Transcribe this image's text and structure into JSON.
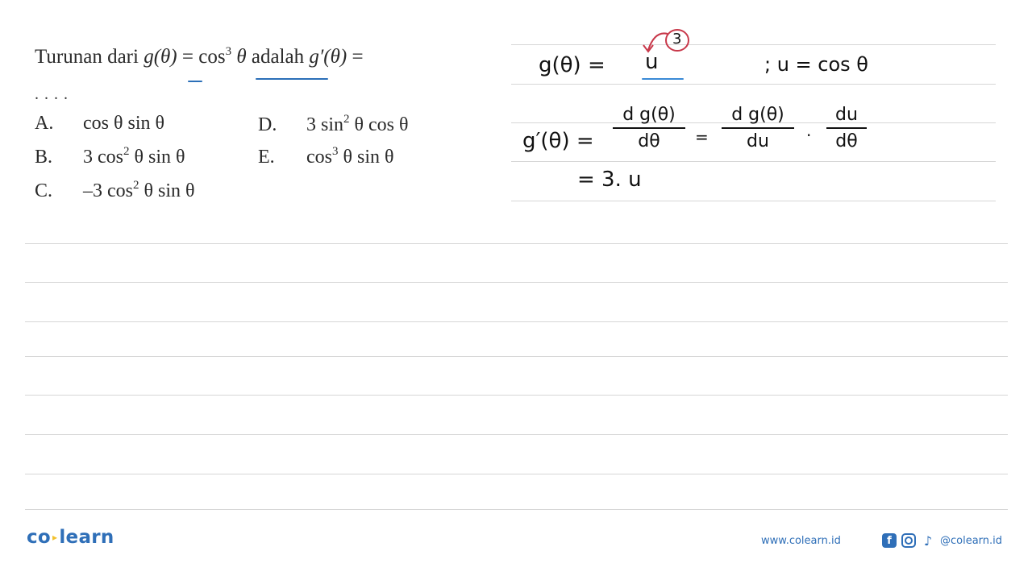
{
  "question": {
    "prefix": "Turunan dari ",
    "g_theta": "g(θ)",
    "equals": " = ",
    "cos": "cos",
    "cube": "3",
    "theta": " θ",
    "middle": " adalah ",
    "g_prime": "g′(θ)",
    "equals2": " =",
    "blank": "...."
  },
  "options": [
    {
      "label": "A.",
      "text": "cos θ sin θ"
    },
    {
      "label": "B.",
      "text_pre": "3 cos",
      "exp": "2",
      "text_post": " θ sin θ"
    },
    {
      "label": "C.",
      "text_pre": "–3 cos",
      "exp": "2",
      "text_post": " θ sin θ"
    },
    {
      "label": "D.",
      "text_pre": "3 sin",
      "exp": "2",
      "text_post": " θ cos θ"
    },
    {
      "label": "E.",
      "text_pre": "cos",
      "exp": "3",
      "text_post": " θ sin θ"
    }
  ],
  "handwriting": {
    "line1_left": "g(θ) = ",
    "line1_u": "u",
    "line1_exp": "3",
    "line1_right": "; u = cos θ",
    "line2_lhs": "g′(θ) =",
    "frac1_num": "d g(θ)",
    "frac1_den": "dθ",
    "eq": "=",
    "frac2_num": "d g(θ)",
    "frac2_den": "du",
    "dot": "·",
    "frac3_num": "du",
    "frac3_den": "dθ",
    "line3": "= 3. u"
  },
  "footer": {
    "logo_left": "co",
    "logo_right": "learn",
    "website": "www.colearn.id",
    "social_handle": "@colearn.id",
    "icons": [
      "facebook-icon",
      "instagram-icon",
      "tiktok-icon"
    ]
  },
  "colors": {
    "brand": "#2f6fb8",
    "annotation_red": "#c8384a",
    "underline_blue": "#2b6fb8"
  }
}
